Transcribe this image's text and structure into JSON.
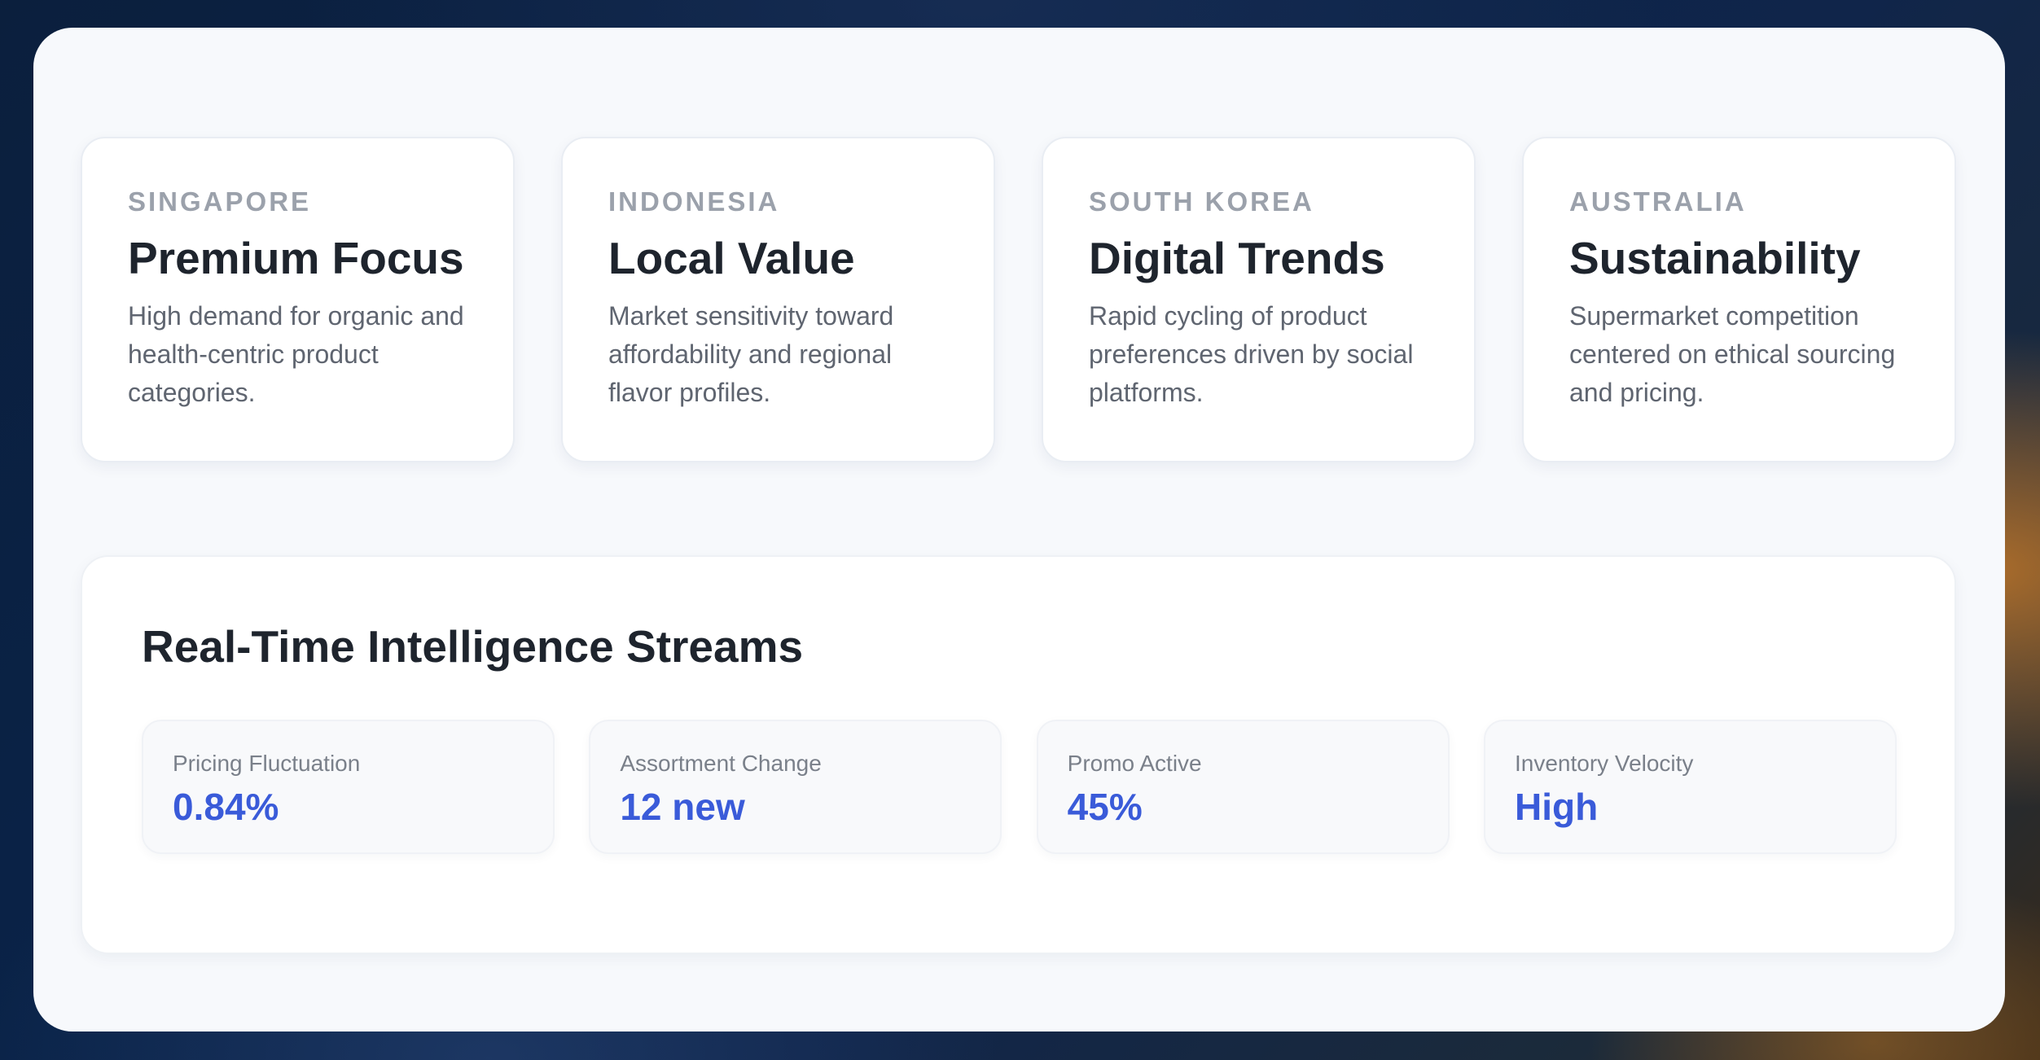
{
  "regions": [
    {
      "country": "SINGAPORE",
      "title": "Premium Focus",
      "description": "High demand for organic and health-centric product categories."
    },
    {
      "country": "INDONESIA",
      "title": "Local Value",
      "description": "Market sensitivity toward affordability and regional flavor profiles."
    },
    {
      "country": "SOUTH KOREA",
      "title": "Digital Trends",
      "description": "Rapid cycling of product preferences driven by social platforms."
    },
    {
      "country": "AUSTRALIA",
      "title": "Sustainability",
      "description": "Supermarket competition centered on ethical sourcing and pricing."
    }
  ],
  "streams": {
    "title": "Real-Time Intelligence Streams",
    "metrics": [
      {
        "label": "Pricing Fluctuation",
        "value": "0.84%"
      },
      {
        "label": "Assortment Change",
        "value": "12 new"
      },
      {
        "label": "Promo Active",
        "value": "45%"
      },
      {
        "label": "Inventory Velocity",
        "value": "High"
      }
    ]
  },
  "colors": {
    "accent": "#3a5bd9",
    "heading": "#1e242d",
    "muted": "#9ba1ab",
    "body_text": "#5f6570",
    "panel_bg": "#f7f9fc"
  }
}
